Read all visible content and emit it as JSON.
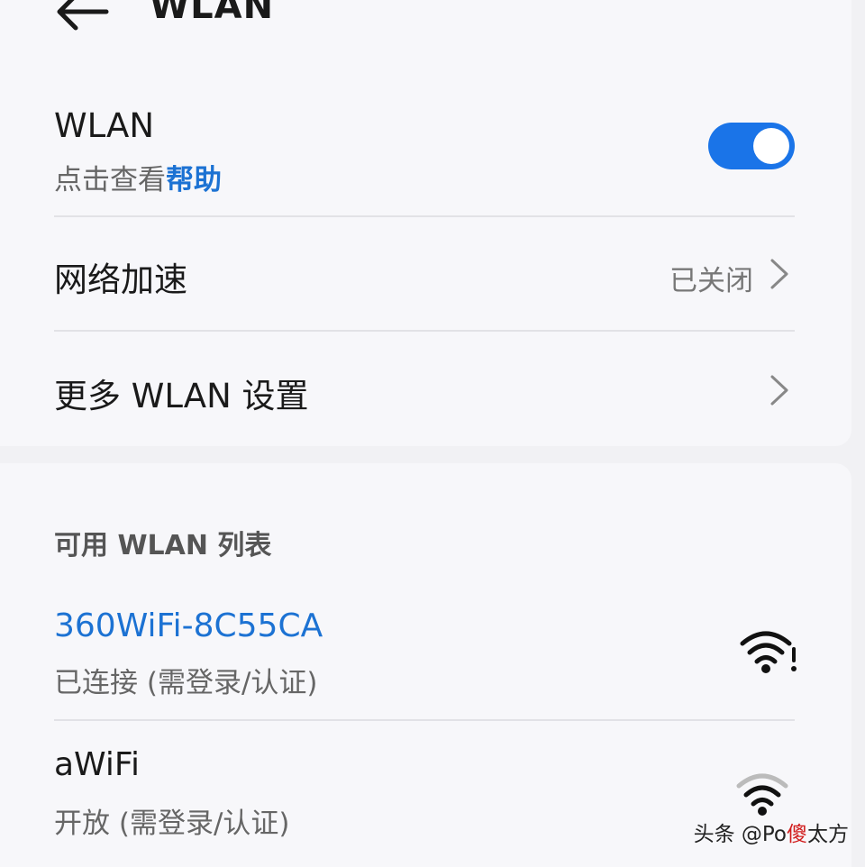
{
  "header": {
    "title": "WLAN",
    "back_icon": "back-arrow-icon"
  },
  "wlan": {
    "title": "WLAN",
    "subtitle_prefix": "点击查看",
    "help_link": "帮助",
    "enabled": true,
    "accent_color": "#1a74e8"
  },
  "network_acceleration": {
    "label": "网络加速",
    "value": "已关闭",
    "icon": "chevron-right-icon"
  },
  "more_settings": {
    "label": "更多 WLAN 设置",
    "icon": "chevron-right-icon"
  },
  "available": {
    "header": "可用 WLAN 列表",
    "networks": [
      {
        "ssid": "360WiFi-8C55CA",
        "status": "已连接 (需登录/认证)",
        "icon": "wifi-warning-icon"
      },
      {
        "ssid": "aWiFi",
        "status": "开放 (需登录/认证)",
        "icon": "wifi-icon"
      }
    ]
  },
  "watermark": {
    "prefix": "头条 @Po",
    "highlight": "傻",
    "suffix": "太方"
  }
}
